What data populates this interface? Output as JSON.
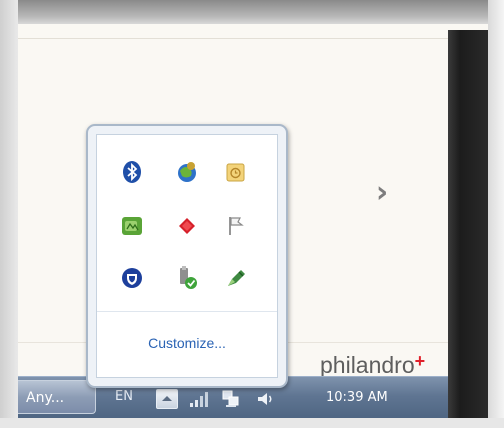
{
  "popup": {
    "icons": [
      {
        "name": "bluetooth-icon"
      },
      {
        "name": "network-globe-icon"
      },
      {
        "name": "calendar-note-icon"
      },
      {
        "name": "green-app-icon"
      },
      {
        "name": "red-diamond-icon"
      },
      {
        "name": "action-center-flag-icon"
      },
      {
        "name": "shield-icon"
      },
      {
        "name": "usb-safely-remove-icon"
      },
      {
        "name": "pen-tool-icon"
      }
    ],
    "customize_label": "Customize..."
  },
  "logo": {
    "text": "philandro",
    "mark": "+"
  },
  "taskbar": {
    "task_button_label": "Any...",
    "language": "EN",
    "clock": "10:39 AM"
  },
  "colors": {
    "taskbar": "#5f7592",
    "link": "#2a63b4",
    "logo_accent": "#e0202a"
  }
}
